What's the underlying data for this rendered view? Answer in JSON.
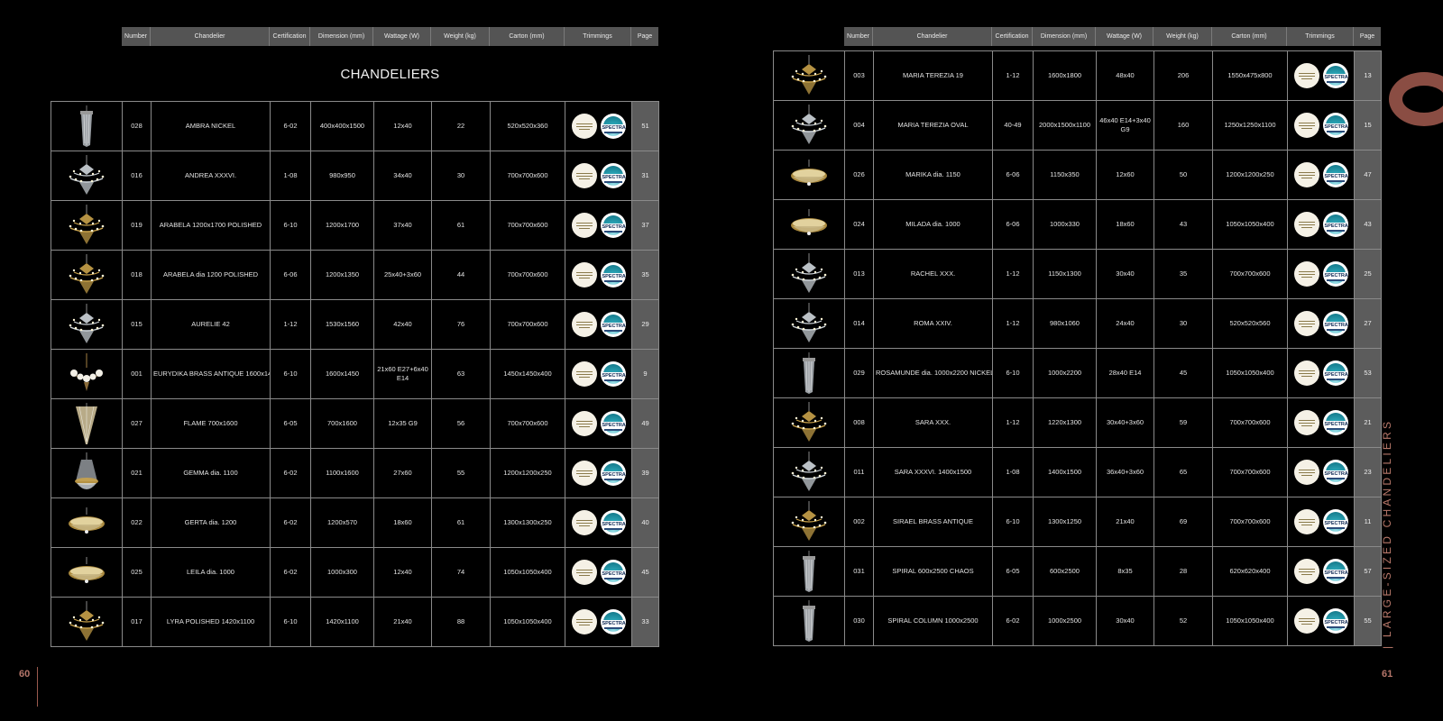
{
  "headers": [
    "Number",
    "Chandelier",
    "Certification",
    "Dimension (mm)",
    "Wattage (W)",
    "Weight (kg)",
    "Carton (mm)",
    "Trimmings",
    "Page"
  ],
  "left": {
    "section_title": "CHANDELIERS",
    "page_number": "60",
    "rows": [
      {
        "number": "028",
        "name": "AMBRA NICKEL",
        "cert": "6-02",
        "dim": "400x400x1500",
        "watt": "12x40",
        "weight": "22",
        "carton": "520x520x360",
        "page": "51",
        "thumb": "column"
      },
      {
        "number": "016",
        "name": "ANDREA XXXVI.",
        "cert": "1-08",
        "dim": "980x950",
        "watt": "34x40",
        "weight": "30",
        "carton": "700x700x600",
        "page": "31",
        "thumb": "crystal"
      },
      {
        "number": "019",
        "name": "ARABELA 1200x1700 POLISHED",
        "cert": "6-10",
        "dim": "1200x1700",
        "watt": "37x40",
        "weight": "61",
        "carton": "700x700x600",
        "page": "37",
        "thumb": "gold"
      },
      {
        "number": "018",
        "name": "ARABELA dia 1200 POLISHED",
        "cert": "6-06",
        "dim": "1200x1350",
        "watt": "25x40+3x60",
        "weight": "44",
        "carton": "700x700x600",
        "page": "35",
        "thumb": "gold"
      },
      {
        "number": "015",
        "name": "AURELIE 42",
        "cert": "1-12",
        "dim": "1530x1560",
        "watt": "42x40",
        "weight": "76",
        "carton": "700x700x600",
        "page": "29",
        "thumb": "crystal"
      },
      {
        "number": "001",
        "name": "EURYDIKA BRASS ANTIQUE 1600x1450",
        "cert": "6-10",
        "dim": "1600x1450",
        "watt": "21x60 E27+6x40 E14",
        "weight": "63",
        "carton": "1450x1450x400",
        "page": "9",
        "thumb": "globes"
      },
      {
        "number": "027",
        "name": "FLAME 700x1600",
        "cert": "6-05",
        "dim": "700x1600",
        "watt": "12x35 G9",
        "weight": "56",
        "carton": "700x700x600",
        "page": "49",
        "thumb": "cone"
      },
      {
        "number": "021",
        "name": "GEMMA dia. 1100",
        "cert": "6-02",
        "dim": "1100x1600",
        "watt": "27x60",
        "weight": "55",
        "carton": "1200x1200x250",
        "page": "39",
        "thumb": "basket"
      },
      {
        "number": "022",
        "name": "GERTA dia. 1200",
        "cert": "6-02",
        "dim": "1200x570",
        "watt": "18x60",
        "weight": "61",
        "carton": "1300x1300x250",
        "page": "40",
        "thumb": "flush"
      },
      {
        "number": "025",
        "name": "LEILA dia. 1000",
        "cert": "6-02",
        "dim": "1000x300",
        "watt": "12x40",
        "weight": "74",
        "carton": "1050x1050x400",
        "page": "45",
        "thumb": "flush"
      },
      {
        "number": "017",
        "name": "LYRA POLISHED 1420x1100",
        "cert": "6-10",
        "dim": "1420x1100",
        "watt": "21x40",
        "weight": "88",
        "carton": "1050x1050x400",
        "page": "33",
        "thumb": "gold"
      }
    ]
  },
  "right": {
    "page_number": "61",
    "side_title": "| LARGE-SIZED CHANDELIERS",
    "rows": [
      {
        "number": "003",
        "name": "MARIA TEREZIA 19",
        "cert": "1-12",
        "dim": "1600x1800",
        "watt": "48x40",
        "weight": "206",
        "carton": "1550x475x800",
        "page": "13",
        "thumb": "gold"
      },
      {
        "number": "004",
        "name": "MARIA TEREZIA OVAL",
        "cert": "40-49",
        "dim": "2000x1500x1100",
        "watt": "46x40 E14+3x40 G9",
        "weight": "160",
        "carton": "1250x1250x1100",
        "page": "15",
        "thumb": "crystal"
      },
      {
        "number": "026",
        "name": "MARIKA dia. 1150",
        "cert": "6-06",
        "dim": "1150x350",
        "watt": "12x60",
        "weight": "50",
        "carton": "1200x1200x250",
        "page": "47",
        "thumb": "flush"
      },
      {
        "number": "024",
        "name": "MILADA dia. 1000",
        "cert": "6-06",
        "dim": "1000x330",
        "watt": "18x60",
        "weight": "43",
        "carton": "1050x1050x400",
        "page": "43",
        "thumb": "flush"
      },
      {
        "number": "013",
        "name": "RACHEL XXX.",
        "cert": "1-12",
        "dim": "1150x1300",
        "watt": "30x40",
        "weight": "35",
        "carton": "700x700x600",
        "page": "25",
        "thumb": "crystal"
      },
      {
        "number": "014",
        "name": "ROMA XXIV.",
        "cert": "1-12",
        "dim": "980x1060",
        "watt": "24x40",
        "weight": "30",
        "carton": "520x520x560",
        "page": "27",
        "thumb": "crystal"
      },
      {
        "number": "029",
        "name": "ROSAMUNDE dia. 1000x2200 NICKEL",
        "cert": "6-10",
        "dim": "1000x2200",
        "watt": "28x40 E14",
        "weight": "45",
        "carton": "1050x1050x400",
        "page": "53",
        "thumb": "column"
      },
      {
        "number": "008",
        "name": "SARA XXX.",
        "cert": "1-12",
        "dim": "1220x1300",
        "watt": "30x40+3x60",
        "weight": "59",
        "carton": "700x700x600",
        "page": "21",
        "thumb": "gold"
      },
      {
        "number": "011",
        "name": "SARA XXXVI. 1400x1500",
        "cert": "1-08",
        "dim": "1400x1500",
        "watt": "36x40+3x60",
        "weight": "65",
        "carton": "700x700x600",
        "page": "23",
        "thumb": "crystal"
      },
      {
        "number": "002",
        "name": "SIRAEL BRASS ANTIQUE",
        "cert": "6-10",
        "dim": "1300x1250",
        "watt": "21x40",
        "weight": "69",
        "carton": "700x700x600",
        "page": "11",
        "thumb": "gold"
      },
      {
        "number": "031",
        "name": "SPIRAL 600x2500 CHAOS",
        "cert": "6-05",
        "dim": "600x2500",
        "watt": "8x35",
        "weight": "28",
        "carton": "620x620x400",
        "page": "57",
        "thumb": "column"
      },
      {
        "number": "030",
        "name": "SPIRAL COLUMN 1000x2500",
        "cert": "6-02",
        "dim": "1000x2500",
        "watt": "30x40",
        "weight": "52",
        "carton": "1050x1050x400",
        "page": "55",
        "thumb": "column"
      }
    ]
  },
  "badges": {
    "spectra_text": "SPECTRA"
  },
  "colors": {
    "accent": "#b5766a",
    "header_bg": "#545454",
    "page_cell_bg": "#5c5c5c"
  }
}
